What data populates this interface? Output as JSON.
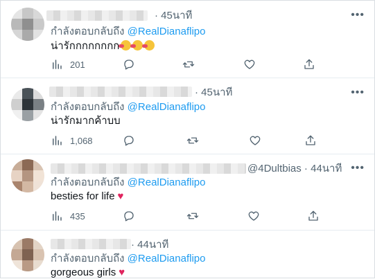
{
  "tweets": [
    {
      "time": "45นาที",
      "reply_label": "กำลังตอบกลับถึง",
      "reply_handle": "@RealDianaflipo",
      "text": "น่ารักกกกกกกก",
      "emoji_count": 3,
      "stat": "201",
      "avatar_colors": [
        "#e5e5e5",
        "#c7c7c7",
        "#d8d8d8",
        "#b9b9b9",
        "#8f8f8f",
        "#c9c9c9",
        "#d6d6d6",
        "#aaaaaa",
        "#e2e2e2"
      ]
    },
    {
      "time": "45นาที",
      "reply_label": "กำลังตอบกลับถึง",
      "reply_handle": "@RealDianaflipo",
      "text": "น่ารักมากค้าบบ",
      "stat": "1,068",
      "avatar_colors": [
        "#eaeaea",
        "#4a5258",
        "#dcdcdc",
        "#cfcfcf",
        "#2e3439",
        "#7a8084",
        "#f0f0f0",
        "#9aa0a4",
        "#e4e4e4"
      ]
    },
    {
      "handle": "@4Dultbias",
      "time": "44นาที",
      "reply_label": "กำลังตอบกลับถึง",
      "reply_handle": "@RealDianaflipo",
      "text": "besties for life",
      "stat": "435",
      "avatar_colors": [
        "#c8ad98",
        "#8c6a55",
        "#d9c4b3",
        "#e7d3c4",
        "#b49581",
        "#f1e3d6",
        "#a9846d",
        "#d3b8a3",
        "#efe2d7"
      ]
    },
    {
      "time": "44นาที",
      "reply_label": "กำลังตอบกลับถึง",
      "reply_handle": "@RealDianaflipo",
      "text": "gorgeous girls",
      "avatar_colors": [
        "#d7c2b0",
        "#9b7a66",
        "#e3d4c6",
        "#c4a894",
        "#7f6251",
        "#d9c3b1",
        "#efe4d9",
        "#b99a85",
        "#e8dccf"
      ]
    }
  ],
  "icons": {
    "more": "more-icon",
    "analytics": "analytics-icon",
    "reply": "reply-icon",
    "retweet": "retweet-icon",
    "like": "like-icon",
    "share": "share-icon"
  },
  "colors": {
    "link": "#1d9bf0",
    "secondary_text": "#536471",
    "heart": "#e0245e"
  }
}
